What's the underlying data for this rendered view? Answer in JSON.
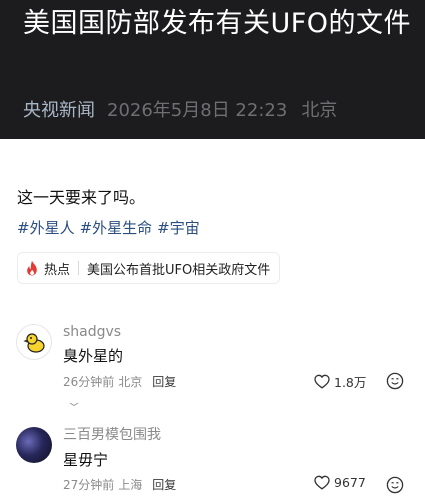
{
  "article": {
    "title": "美国国防部发布有关UFO的文件",
    "source": "央视新闻",
    "time": "2026年5月8日 22:23",
    "location": "北京",
    "body": "这一天要来了吗。",
    "tags": [
      "#外星人",
      "#外星生命",
      "#宇宙"
    ]
  },
  "hot_chip": {
    "label": "热点",
    "title": "美国公布首批UFO相关政府文件",
    "icon": "fire-icon",
    "color": "#e53935"
  },
  "comments": [
    {
      "user": "shadgvs",
      "text": "臭外星的",
      "time": "26分钟前",
      "location": "北京",
      "reply_label": "回复",
      "likes": "1.8万"
    },
    {
      "user": "三百男模包围我",
      "text": "星毋宁",
      "time": "27分钟前",
      "location": "上海",
      "reply_label": "回复",
      "likes": "9677"
    }
  ],
  "colors": {
    "header_bg": "#1c1c1e",
    "source_color": "#a9b6c6",
    "tag_color": "#2a4f80"
  }
}
